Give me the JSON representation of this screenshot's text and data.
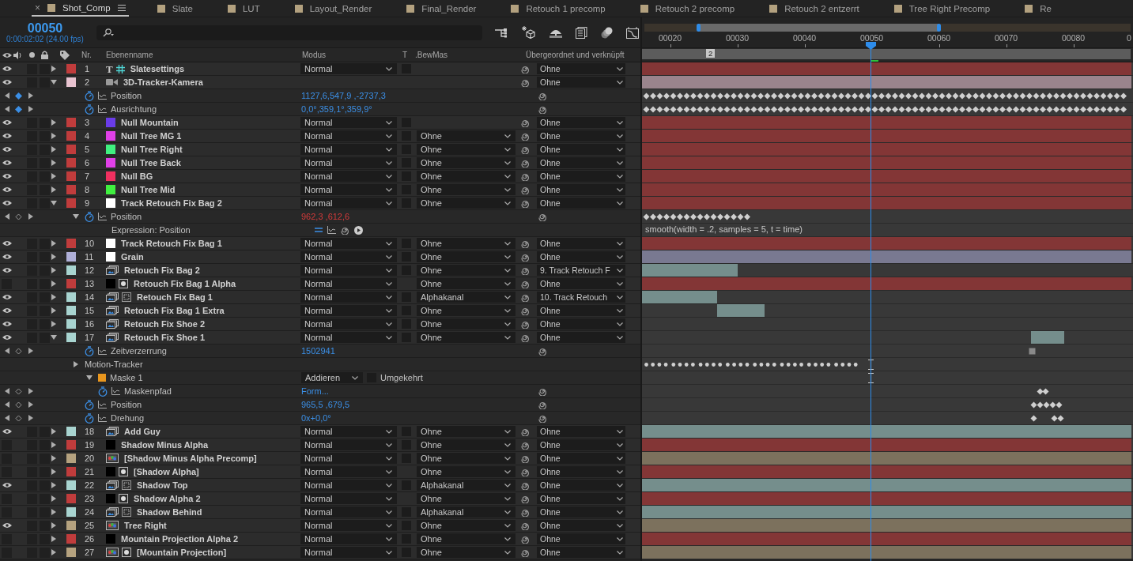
{
  "tab_close": "×",
  "tabs": [
    {
      "label": "Shot_Comp",
      "selected": true
    },
    {
      "label": "Slate",
      "selected": false
    },
    {
      "label": "LUT",
      "selected": false
    },
    {
      "label": "Layout_Render",
      "selected": false
    },
    {
      "label": "Final_Render",
      "selected": false
    },
    {
      "label": "Retouch 1 precomp",
      "selected": false
    },
    {
      "label": "Retouch 2 precomp",
      "selected": false
    },
    {
      "label": "Retouch 2 entzerrt",
      "selected": false
    },
    {
      "label": "Tree Right Precomp",
      "selected": false
    },
    {
      "label": "Re",
      "selected": false
    }
  ],
  "time": {
    "frame": "00050",
    "timecode": "0:00:02:02 (24.00 fps)"
  },
  "columns": {
    "number": "Nr.",
    "name": "Ebenenname",
    "mode": "Modus",
    "preserve": "T",
    "track_matte": ".BewMas",
    "parent": "Übergeordnet und verknüpft"
  },
  "ruler": [
    "00020",
    "00030",
    "00040",
    "00050",
    "00060",
    "00070",
    "00080",
    "0"
  ],
  "marker_label": "2",
  "layers": [
    {
      "kind": "layer",
      "number": "1",
      "name": "Slatesettings",
      "visible": true,
      "expanded": false,
      "color": "#c03c3c",
      "source": {
        "kind": "text",
        "glyph": "T"
      },
      "mode": "Normal",
      "preserve_transparency": false,
      "parent": "Ohne",
      "track": {
        "kind": "full"
      }
    },
    {
      "kind": "layer",
      "number": "2",
      "name": "3D-Tracker-Kamera",
      "visible": true,
      "expanded": true,
      "color": "#e8c3d0",
      "source": {
        "kind": "camera"
      },
      "parent": "Ohne",
      "track": {
        "kind": "full"
      },
      "children": [
        {
          "kind": "property",
          "name": "Position",
          "value": "1127,6,547,9 ,-2737,3",
          "at_keyframe": true,
          "expression": false,
          "keyframes": {
            "kind": "dense"
          }
        },
        {
          "kind": "property",
          "name": "Ausrichtung",
          "value": "0,0°,359,1°,359,9°",
          "at_keyframe": true,
          "expression": false,
          "keyframes": {
            "kind": "dense"
          }
        }
      ]
    },
    {
      "kind": "layer",
      "number": "3",
      "name": "Null Mountain",
      "visible": true,
      "expanded": false,
      "color": "#c03c3c",
      "source": {
        "kind": "solid",
        "color": "#6a3ce8"
      },
      "mode": "Normal",
      "preserve_transparency": false,
      "parent": "Ohne",
      "track": {
        "kind": "full"
      }
    },
    {
      "kind": "layer",
      "number": "4",
      "name": "Null Tree MG 1",
      "visible": true,
      "expanded": false,
      "color": "#c03c3c",
      "source": {
        "kind": "solid",
        "color": "#e040e8"
      },
      "mode": "Normal",
      "preserve_transparency": false,
      "track_matte": "Ohne",
      "parent": "Ohne",
      "track": {
        "kind": "full"
      }
    },
    {
      "kind": "layer",
      "number": "5",
      "name": "Null Tree Right",
      "visible": true,
      "expanded": false,
      "color": "#c03c3c",
      "source": {
        "kind": "solid",
        "color": "#40f080"
      },
      "mode": "Normal",
      "preserve_transparency": false,
      "track_matte": "Ohne",
      "parent": "Ohne",
      "track": {
        "kind": "full"
      }
    },
    {
      "kind": "layer",
      "number": "6",
      "name": "Null Tree Back",
      "visible": true,
      "expanded": false,
      "color": "#c03c3c",
      "source": {
        "kind": "solid",
        "color": "#e040e8"
      },
      "mode": "Normal",
      "preserve_transparency": false,
      "track_matte": "Ohne",
      "parent": "Ohne",
      "track": {
        "kind": "full"
      }
    },
    {
      "kind": "layer",
      "number": "7",
      "name": "Null BG",
      "visible": true,
      "expanded": false,
      "color": "#c03c3c",
      "source": {
        "kind": "solid",
        "color": "#f03060"
      },
      "mode": "Normal",
      "preserve_transparency": false,
      "track_matte": "Ohne",
      "parent": "Ohne",
      "track": {
        "kind": "full"
      }
    },
    {
      "kind": "layer",
      "number": "8",
      "name": "Null Tree Mid",
      "visible": true,
      "expanded": false,
      "color": "#c03c3c",
      "source": {
        "kind": "solid",
        "color": "#40f040"
      },
      "mode": "Normal",
      "preserve_transparency": false,
      "track_matte": "Ohne",
      "parent": "Ohne",
      "track": {
        "kind": "full"
      }
    },
    {
      "kind": "layer",
      "number": "9",
      "name": "Track Retouch Fix Bag 2",
      "visible": true,
      "expanded": true,
      "color": "#c03c3c",
      "source": {
        "kind": "solid",
        "color": "#ffffff"
      },
      "mode": "Normal",
      "preserve_transparency": false,
      "track_matte": "Ohne",
      "parent": "Ohne",
      "track": {
        "kind": "full"
      },
      "children": [
        {
          "kind": "property",
          "name": "Position",
          "value": "962,3 ,612,6",
          "at_keyframe": false,
          "expression": true,
          "expanded": true,
          "keyframes": {
            "kind": "dense_short"
          },
          "children": [
            {
              "kind": "expression",
              "label": "Expression: Position",
              "code": "smooth(width = .2, samples = 5, t = time)"
            }
          ]
        }
      ]
    },
    {
      "kind": "layer",
      "number": "10",
      "name": "Track Retouch Fix Bag 1",
      "visible": true,
      "expanded": false,
      "color": "#c03c3c",
      "source": {
        "kind": "solid",
        "color": "#ffffff"
      },
      "mode": "Normal",
      "preserve_transparency": false,
      "track_matte": "Ohne",
      "parent": "Ohne",
      "track": {
        "kind": "full"
      }
    },
    {
      "kind": "layer",
      "number": "11",
      "name": "Grain",
      "visible": true,
      "expanded": false,
      "color": "#b0b0d8",
      "source": {
        "kind": "solid",
        "color": "#ffffff"
      },
      "mode": "Normal",
      "preserve_transparency": false,
      "track_matte": "Ohne",
      "parent": "Ohne",
      "track": {
        "kind": "full"
      }
    },
    {
      "kind": "layer",
      "number": "12",
      "name": "Retouch Fix Bag 2",
      "visible": true,
      "expanded": false,
      "color": "#a8d4d0",
      "source": {
        "kind": "precomp"
      },
      "mode": "Normal",
      "preserve_transparency": false,
      "track_matte": "Ohne",
      "parent": "9. Track Retouch F",
      "track": {
        "kind": "head_long"
      }
    },
    {
      "kind": "layer",
      "number": "13",
      "name": "Retouch Fix Bag 1 Alpha",
      "visible": false,
      "expanded": false,
      "color": "#c03c3c",
      "source": {
        "kind": "solid",
        "color": "#000000"
      },
      "matte": {
        "kind": "source"
      },
      "mode": "Normal",
      "track_matte": "Ohne",
      "parent": "Ohne",
      "track": {
        "kind": "full"
      }
    },
    {
      "kind": "layer",
      "number": "14",
      "name": "Retouch Fix Bag 1",
      "visible": true,
      "expanded": false,
      "color": "#a8d4d0",
      "source": {
        "kind": "precomp"
      },
      "matte": {
        "kind": "target"
      },
      "mode": "Normal",
      "preserve_transparency": false,
      "track_matte": "Alphakanal",
      "parent": "10. Track Retouch",
      "track": {
        "kind": "head_short"
      }
    },
    {
      "kind": "layer",
      "number": "15",
      "name": "Retouch Fix Bag 1 Extra",
      "visible": true,
      "expanded": false,
      "color": "#a8d4d0",
      "source": {
        "kind": "precomp"
      },
      "mode": "Normal",
      "preserve_transparency": false,
      "track_matte": "Ohne",
      "parent": "Ohne",
      "track": {
        "kind": "middle"
      }
    },
    {
      "kind": "layer",
      "number": "16",
      "name": "Retouch Fix Shoe 2",
      "visible": true,
      "expanded": false,
      "color": "#a8d4d0",
      "source": {
        "kind": "precomp"
      },
      "mode": "Normal",
      "preserve_transparency": false,
      "track_matte": "Ohne",
      "parent": "Ohne",
      "track": {
        "kind": "none"
      }
    },
    {
      "kind": "layer",
      "number": "17",
      "name": "Retouch Fix Shoe 1",
      "visible": true,
      "expanded": true,
      "color": "#a8d4d0",
      "source": {
        "kind": "precomp"
      },
      "mode": "Normal",
      "preserve_transparency": false,
      "track_matte": "Ohne",
      "parent": "Ohne",
      "track": {
        "kind": "late"
      },
      "children": [
        {
          "kind": "property",
          "name": "Zeitverzerrung",
          "value": "1502941",
          "at_keyframe": false,
          "expression": false,
          "keyframes": {
            "kind": "hold"
          }
        },
        {
          "kind": "group",
          "name": "Motion-Tracker",
          "expanded": false,
          "keyframes": {
            "kind": "tracker"
          }
        },
        {
          "kind": "mask",
          "name": "Maske 1",
          "expanded": true,
          "color": "#e8961e",
          "mode": "Addieren",
          "inverted": false,
          "inverted_label": "Umgekehrt",
          "keyframes": {
            "kind": "ibeam"
          },
          "children": [
            {
              "kind": "property",
              "name": "Maskenpfad",
              "value": "Form...",
              "at_keyframe": false,
              "expression": false,
              "keyframes": {
                "kind": "pair"
              }
            }
          ]
        },
        {
          "kind": "property",
          "name": "Position",
          "value": "965,5 ,679,5",
          "at_keyframe": false,
          "expression": false,
          "keyframes": {
            "kind": "run"
          }
        },
        {
          "kind": "property",
          "name": "Drehung",
          "value": "0x+0,0°",
          "at_keyframe": false,
          "expression": false,
          "keyframes": {
            "kind": "split"
          }
        }
      ]
    },
    {
      "kind": "layer",
      "number": "18",
      "name": "Add Guy",
      "visible": true,
      "expanded": false,
      "color": "#a8d4d0",
      "source": {
        "kind": "precomp"
      },
      "mode": "Normal",
      "preserve_transparency": false,
      "track_matte": "Ohne",
      "parent": "Ohne",
      "track": {
        "kind": "full"
      }
    },
    {
      "kind": "layer",
      "number": "19",
      "name": "Shadow Minus Alpha",
      "visible": false,
      "expanded": false,
      "color": "#c03c3c",
      "source": {
        "kind": "solid",
        "color": "#000000"
      },
      "mode": "Normal",
      "preserve_transparency": false,
      "track_matte": "Ohne",
      "parent": "Ohne",
      "track": {
        "kind": "full"
      }
    },
    {
      "kind": "layer",
      "number": "20",
      "name": "[Shadow Minus Alpha Precomp]",
      "visible": false,
      "expanded": false,
      "color": "#b5a27f",
      "source": {
        "kind": "footage"
      },
      "mode": "Normal",
      "preserve_transparency": false,
      "track_matte": "Ohne",
      "parent": "Ohne",
      "track": {
        "kind": "full"
      }
    },
    {
      "kind": "layer",
      "number": "21",
      "name": "[Shadow Alpha]",
      "visible": false,
      "expanded": false,
      "color": "#c03c3c",
      "source": {
        "kind": "solid",
        "color": "#000000"
      },
      "matte": {
        "kind": "source"
      },
      "mode": "Normal",
      "track_matte": "Ohne",
      "parent": "Ohne",
      "track": {
        "kind": "full"
      }
    },
    {
      "kind": "layer",
      "number": "22",
      "name": "Shadow Top",
      "visible": true,
      "expanded": false,
      "color": "#a8d4d0",
      "source": {
        "kind": "precomp"
      },
      "matte": {
        "kind": "target"
      },
      "mode": "Normal",
      "preserve_transparency": false,
      "track_matte": "Alphakanal",
      "parent": "Ohne",
      "track": {
        "kind": "full"
      }
    },
    {
      "kind": "layer",
      "number": "23",
      "name": "Shadow Alpha 2",
      "visible": false,
      "expanded": false,
      "color": "#c03c3c",
      "source": {
        "kind": "solid",
        "color": "#000000"
      },
      "matte": {
        "kind": "source"
      },
      "mode": "Normal",
      "track_matte": "Ohne",
      "parent": "Ohne",
      "track": {
        "kind": "full"
      }
    },
    {
      "kind": "layer",
      "number": "24",
      "name": "Shadow Behind",
      "visible": false,
      "expanded": false,
      "color": "#a8d4d0",
      "source": {
        "kind": "precomp"
      },
      "matte": {
        "kind": "target"
      },
      "mode": "Normal",
      "preserve_transparency": false,
      "track_matte": "Alphakanal",
      "parent": "Ohne",
      "track": {
        "kind": "full"
      }
    },
    {
      "kind": "layer",
      "number": "25",
      "name": "Tree Right",
      "visible": true,
      "expanded": false,
      "color": "#b5a27f",
      "source": {
        "kind": "footage"
      },
      "mode": "Normal",
      "preserve_transparency": false,
      "track_matte": "Ohne",
      "parent": "Ohne",
      "track": {
        "kind": "full"
      }
    },
    {
      "kind": "layer",
      "number": "26",
      "name": "Mountain Projection Alpha 2",
      "visible": false,
      "expanded": false,
      "color": "#c03c3c",
      "source": {
        "kind": "solid",
        "color": "#000000"
      },
      "mode": "Normal",
      "preserve_transparency": false,
      "track_matte": "Ohne",
      "parent": "Ohne",
      "track": {
        "kind": "full"
      }
    },
    {
      "kind": "layer",
      "number": "27",
      "name": "[Mountain Projection]",
      "visible": false,
      "expanded": false,
      "color": "#b5a27f",
      "source": {
        "kind": "footage"
      },
      "matte": {
        "kind": "source"
      },
      "mode": "Normal",
      "preserve_transparency": false,
      "track_matte": "Ohne",
      "parent": "Ohne",
      "track": {
        "kind": "full"
      }
    }
  ]
}
